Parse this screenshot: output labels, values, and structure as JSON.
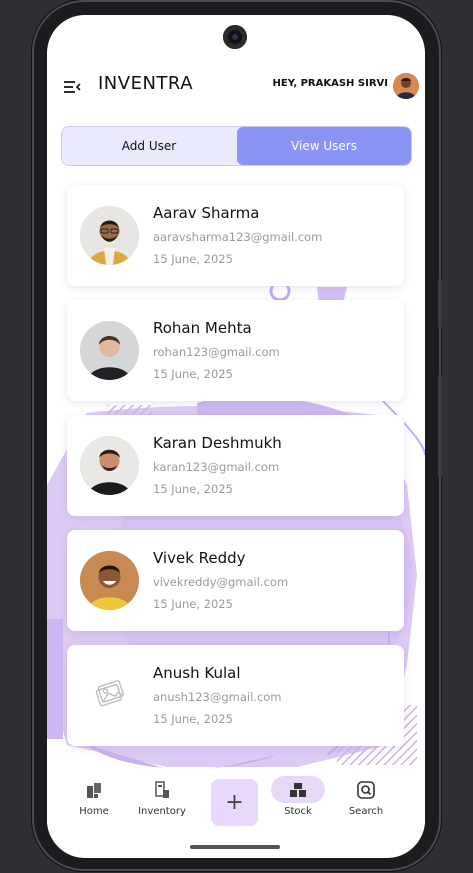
{
  "app": {
    "brand": "INVENTRA",
    "greeting": "HEY, PRAKASH SIRVI"
  },
  "tabs": {
    "add_user": "Add User",
    "view_users": "View Users",
    "active": "View Users"
  },
  "users": [
    {
      "name": "Aarav Sharma",
      "email": "aaravsharma123@gmail.com",
      "date": "15 June, 2025",
      "avatar": "photo"
    },
    {
      "name": "Rohan Mehta",
      "email": "rohan123@gmail.com",
      "date": "15 June, 2025",
      "avatar": "photo"
    },
    {
      "name": "Karan Deshmukh",
      "email": "karan123@gmail.com",
      "date": "15 June, 2025",
      "avatar": "photo"
    },
    {
      "name": "Vivek Reddy",
      "email": "vivekreddy@gmail.com",
      "date": "15 June, 2025",
      "avatar": "photo"
    },
    {
      "name": "Anush Kulal",
      "email": "anush123@gmail.com",
      "date": "15 June, 2025",
      "avatar": "placeholder-image-icon"
    }
  ],
  "nav": {
    "home": "Home",
    "inventory": "Inventory",
    "add": "+",
    "stock": "Stock",
    "search": "Search",
    "active": "Stock"
  },
  "colors": {
    "accent": "#8b93f5",
    "tab_bg": "#e9eafc",
    "decor_purple": "#d6c3f1",
    "add_button_bg": "#e9d8fb"
  }
}
